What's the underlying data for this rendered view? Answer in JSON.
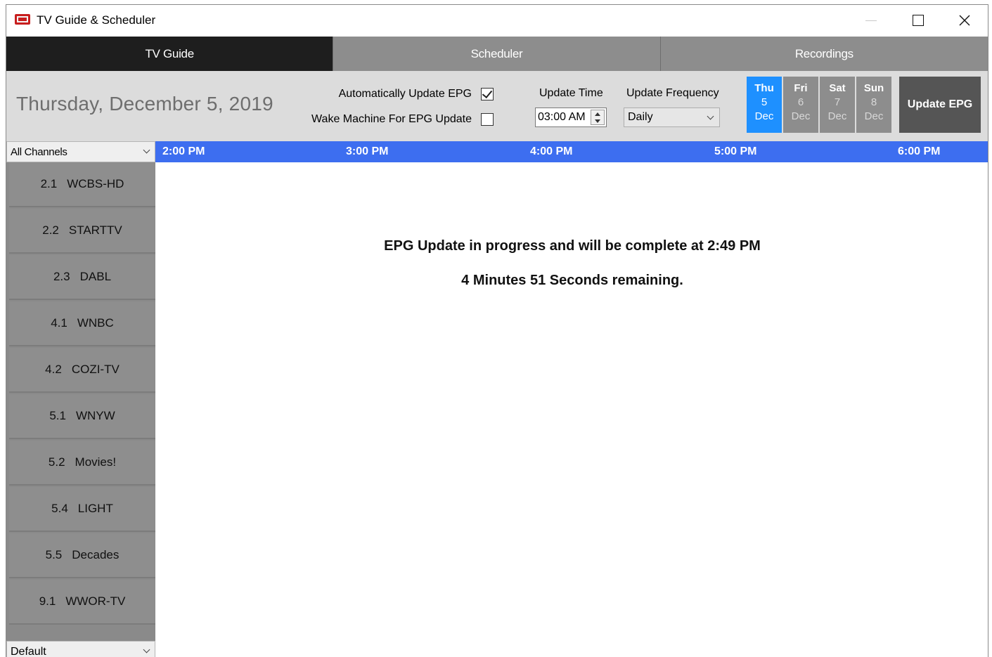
{
  "window": {
    "title": "TV Guide & Scheduler"
  },
  "tabs": [
    {
      "label": "TV Guide",
      "active": true
    },
    {
      "label": "Scheduler",
      "active": false
    },
    {
      "label": "Recordings",
      "active": false
    }
  ],
  "header": {
    "date": "Thursday, December 5, 2019",
    "auto_update_label": "Automatically Update EPG",
    "auto_update_checked": true,
    "wake_label": "Wake Machine For EPG Update",
    "wake_checked": false,
    "update_time_label": "Update Time",
    "update_time_value": "03:00 AM",
    "update_freq_label": "Update Frequency",
    "update_freq_value": "Daily",
    "days": [
      {
        "name": "Thu",
        "num": "5",
        "mon": "Dec",
        "active": true
      },
      {
        "name": "Fri",
        "num": "6",
        "mon": "Dec",
        "active": false
      },
      {
        "name": "Sat",
        "num": "7",
        "mon": "Dec",
        "active": false
      },
      {
        "name": "Sun",
        "num": "8",
        "mon": "Dec",
        "active": false
      }
    ],
    "update_button": "Update EPG"
  },
  "channel_filter": "All Channels",
  "channels": [
    {
      "num": "2.1",
      "name": "WCBS-HD"
    },
    {
      "num": "2.2",
      "name": "STARTTV"
    },
    {
      "num": "2.3",
      "name": "DABL"
    },
    {
      "num": "4.1",
      "name": "WNBC"
    },
    {
      "num": "4.2",
      "name": "COZI-TV"
    },
    {
      "num": "5.1",
      "name": "WNYW"
    },
    {
      "num": "5.2",
      "name": "Movies!"
    },
    {
      "num": "5.4",
      "name": "LIGHT"
    },
    {
      "num": "5.5",
      "name": "Decades"
    },
    {
      "num": "9.1",
      "name": "WWOR-TV"
    }
  ],
  "profile": "Default",
  "times": [
    "2:00 PM",
    "3:00 PM",
    "4:00 PM",
    "5:00 PM",
    "6:00 PM"
  ],
  "message": {
    "line1": "EPG Update in progress and will be complete at 2:49 PM",
    "line2": "4 Minutes 51 Seconds remaining."
  },
  "colors": {
    "active_tab": "#1e1e1e",
    "inactive_tab": "#8d8d8d",
    "active_day": "#1e90ff",
    "timebar": "#3d6ef0"
  }
}
